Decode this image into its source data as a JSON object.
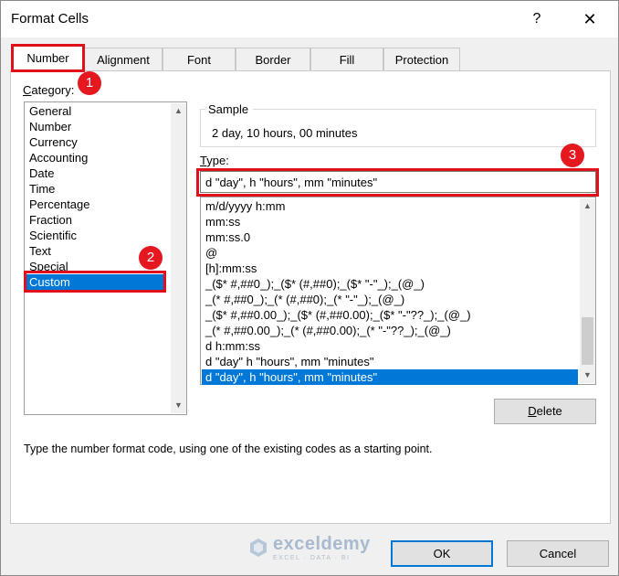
{
  "window": {
    "title": "Format Cells",
    "help_label": "?",
    "close_label": "✕"
  },
  "tabs": [
    {
      "label": "Number"
    },
    {
      "label": "Alignment"
    },
    {
      "label": "Font"
    },
    {
      "label": "Border"
    },
    {
      "label": "Fill"
    },
    {
      "label": "Protection"
    }
  ],
  "category": {
    "label_first": "C",
    "label_rest": "ategory:",
    "items": [
      "General",
      "Number",
      "Currency",
      "Accounting",
      "Date",
      "Time",
      "Percentage",
      "Fraction",
      "Scientific",
      "Text",
      "Special",
      "Custom"
    ],
    "selected": "Custom"
  },
  "sample": {
    "label": "Sample",
    "value": "2 day, 10 hours, 00 minutes"
  },
  "type": {
    "label_first": "T",
    "label_rest": "ype:",
    "value": "d \"day\", h \"hours\", mm \"minutes\"",
    "formats": [
      "m/d/yyyy h:mm",
      "mm:ss",
      "mm:ss.0",
      "@",
      "[h]:mm:ss",
      "_($* #,##0_);_($* (#,##0);_($* \"-\"_);_(@_)",
      "_(* #,##0_);_(* (#,##0);_(* \"-\"_);_(@_)",
      "_($* #,##0.00_);_($* (#,##0.00);_($* \"-\"??_);_(@_)",
      "_(* #,##0.00_);_(* (#,##0.00);_(* \"-\"??_);_(@_)",
      "d h:mm:ss",
      "d \"day\" h \"hours\", mm \"minutes\"",
      "d \"day\", h \"hours\", mm \"minutes\""
    ],
    "selected": "d \"day\", h \"hours\", mm \"minutes\""
  },
  "buttons": {
    "delete_first": "D",
    "delete_rest": "elete",
    "ok": "OK",
    "cancel": "Cancel"
  },
  "hint": "Type the number format code, using one of the existing codes as a starting point.",
  "annotations": {
    "badge1": "1",
    "badge2": "2",
    "badge3": "3",
    "color": "#e0101c"
  },
  "watermark": {
    "name": "exceldemy",
    "tagline": "EXCEL · DATA · BI"
  }
}
